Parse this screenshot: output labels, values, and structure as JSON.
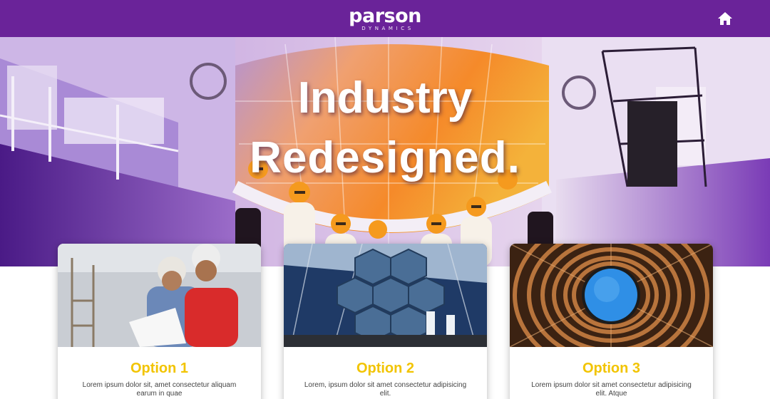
{
  "header": {
    "logo_text": "parson",
    "logo_tagline": "DYNAMICS",
    "home_icon": "home-icon"
  },
  "hero": {
    "title_line1": "Industry",
    "title_line2": "Redesigned."
  },
  "cards": [
    {
      "title": "Option 1",
      "text": "Lorem ipsum dolor sit, amet consectetur aliquam earum in quae",
      "image": "workers-with-hard-hats-photo"
    },
    {
      "title": "Option 2",
      "text": "Lorem, ipsum dolor sit amet consectetur adipisicing elit.",
      "image": "hexagonal-mirror-array-photo"
    },
    {
      "title": "Option 3",
      "text": "Lorem ipsum dolor sit amet consectetur adipisicing elit. Atque",
      "image": "copper-coil-tunnel-photo"
    }
  ],
  "colors": {
    "nav_background": "#6a2399",
    "card_title": "#f2c400",
    "hero_accent": "#f47a2a"
  }
}
